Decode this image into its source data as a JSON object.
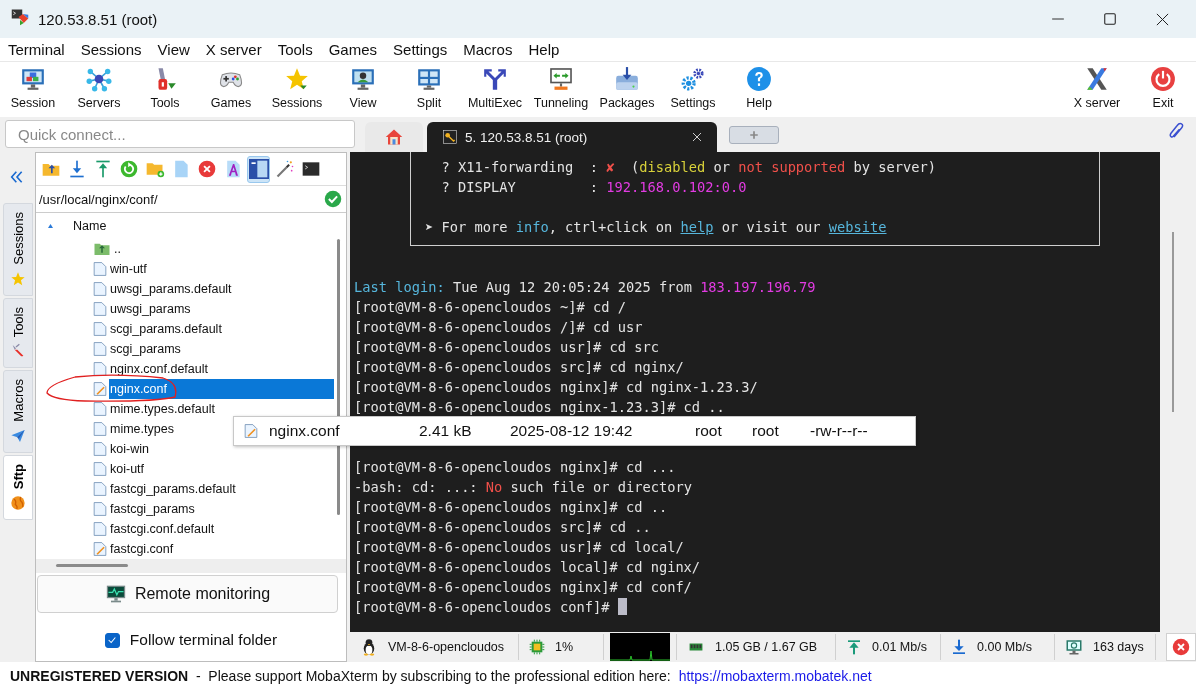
{
  "window": {
    "title": "120.53.8.51 (root)"
  },
  "menu": [
    "Terminal",
    "Sessions",
    "View",
    "X server",
    "Tools",
    "Games",
    "Settings",
    "Macros",
    "Help"
  ],
  "toolbar": [
    {
      "kind": "session",
      "label": "Session"
    },
    {
      "kind": "servers",
      "label": "Servers"
    },
    {
      "kind": "tools",
      "label": "Tools"
    },
    {
      "kind": "games",
      "label": "Games"
    },
    {
      "kind": "sessions",
      "label": "Sessions"
    },
    {
      "kind": "view",
      "label": "View"
    },
    {
      "kind": "split",
      "label": "Split"
    },
    {
      "kind": "multiexec",
      "label": "MultiExec"
    },
    {
      "kind": "tunneling",
      "label": "Tunneling"
    },
    {
      "kind": "packages",
      "label": "Packages"
    },
    {
      "kind": "settings",
      "label": "Settings"
    },
    {
      "kind": "help",
      "label": "Help"
    }
  ],
  "toolbar_right": [
    {
      "kind": "xserver",
      "label": "X server"
    },
    {
      "kind": "exit",
      "label": "Exit"
    }
  ],
  "quick_connect": {
    "placeholder": "Quick connect..."
  },
  "tabs": [
    {
      "kind": "home",
      "selected": false
    },
    {
      "kind": "session",
      "label": "5. 120.53.8.51 (root)",
      "selected": true
    },
    {
      "kind": "new"
    }
  ],
  "side_tabs": [
    {
      "kind": "sessions",
      "label": "Sessions",
      "selected": false
    },
    {
      "kind": "tools",
      "label": "Tools",
      "selected": false
    },
    {
      "kind": "macros",
      "label": "Macros",
      "selected": false
    },
    {
      "kind": "sftp",
      "label": "Sftp",
      "selected": true
    }
  ],
  "sftp": {
    "tools": [
      {
        "kind": "parent",
        "selected": false
      },
      {
        "kind": "download",
        "selected": false
      },
      {
        "kind": "upload",
        "selected": false
      },
      {
        "kind": "refresh",
        "selected": false
      },
      {
        "kind": "new-folder",
        "selected": false
      },
      {
        "kind": "new-file",
        "selected": false
      },
      {
        "kind": "delete",
        "selected": false
      },
      {
        "kind": "font",
        "selected": false
      },
      {
        "kind": "panel",
        "selected": true
      },
      {
        "kind": "wand",
        "selected": false
      },
      {
        "kind": "terminal",
        "selected": false
      }
    ],
    "path": "/usr/local/nginx/conf/",
    "column": "Name",
    "files": [
      {
        "name": "..",
        "kind": "parent",
        "selected": false
      },
      {
        "name": "win-utf",
        "kind": "file",
        "selected": false
      },
      {
        "name": "uwsgi_params.default",
        "kind": "file",
        "selected": false
      },
      {
        "name": "uwsgi_params",
        "kind": "file",
        "selected": false
      },
      {
        "name": "scgi_params.default",
        "kind": "file",
        "selected": false
      },
      {
        "name": "scgi_params",
        "kind": "file",
        "selected": false
      },
      {
        "name": "nginx.conf.default",
        "kind": "file",
        "selected": false
      },
      {
        "name": "nginx.conf",
        "kind": "conf",
        "selected": true
      },
      {
        "name": "mime.types.default",
        "kind": "file",
        "selected": false
      },
      {
        "name": "mime.types",
        "kind": "file",
        "selected": false
      },
      {
        "name": "koi-win",
        "kind": "file",
        "selected": false
      },
      {
        "name": "koi-utf",
        "kind": "file",
        "selected": false
      },
      {
        "name": "fastcgi_params.default",
        "kind": "file",
        "selected": false
      },
      {
        "name": "fastcgi_params",
        "kind": "file",
        "selected": false
      },
      {
        "name": "fastcgi.conf.default",
        "kind": "file",
        "selected": false
      },
      {
        "name": "fastcgi.conf",
        "kind": "conf",
        "selected": false
      }
    ],
    "remote_monitoring": "Remote monitoring",
    "follow": {
      "label": "Follow terminal folder",
      "checked": true
    }
  },
  "tooltip": {
    "name": "nginx.conf",
    "size": "2.41 kB",
    "date": "2025-08-12 19:42",
    "owner": "root",
    "group": "root",
    "permissions": "-rw-r--r--"
  },
  "terminal": {
    "banner": [
      {
        "segments": [
          {
            "text": "  ? X11-forwarding  : ",
            "kind": "plain"
          },
          {
            "text": "✘",
            "kind": "red"
          },
          {
            "text": "  (",
            "kind": "plain"
          },
          {
            "text": "disabled",
            "kind": "yellow"
          },
          {
            "text": " or ",
            "kind": "plain"
          },
          {
            "text": "not supported",
            "kind": "red"
          },
          {
            "text": " by server)",
            "kind": "plain"
          }
        ]
      },
      {
        "segments": [
          {
            "text": "  ? DISPLAY         : ",
            "kind": "plain"
          },
          {
            "text": "192.168.0.102:0.0",
            "kind": "magenta"
          }
        ]
      },
      {
        "segments": [
          {
            "text": "➤ For more ",
            "kind": "plain"
          },
          {
            "text": "info",
            "kind": "cyan"
          },
          {
            "text": ", ctrl+click on ",
            "kind": "plain"
          },
          {
            "text": "help",
            "kind": "link"
          },
          {
            "text": " or visit our ",
            "kind": "plain"
          },
          {
            "text": "website",
            "kind": "link"
          }
        ]
      }
    ],
    "lines": [
      {
        "segments": [
          {
            "text": "Last login:",
            "kind": "cyan"
          },
          {
            "text": " Tue Aug 12 20:05:24 2025 from ",
            "kind": "plain"
          },
          {
            "text": "183.197.196.79",
            "kind": "magenta"
          }
        ]
      },
      {
        "segments": [
          {
            "text": "[root@VM-8-6-opencloudos ~]# cd /",
            "kind": "plain"
          }
        ]
      },
      {
        "segments": [
          {
            "text": "[root@VM-8-6-opencloudos /]# cd usr",
            "kind": "plain"
          }
        ]
      },
      {
        "segments": [
          {
            "text": "[root@VM-8-6-opencloudos usr]# cd src",
            "kind": "plain"
          }
        ]
      },
      {
        "segments": [
          {
            "text": "[root@VM-8-6-opencloudos src]# cd nginx/",
            "kind": "plain"
          }
        ]
      },
      {
        "segments": [
          {
            "text": "[root@VM-8-6-opencloudos nginx]# cd nginx-1.23.3/",
            "kind": "plain"
          }
        ]
      },
      {
        "segments": [
          {
            "text": "[root@VM-8-6-opencloudos nginx-1.23.3]# cd ..",
            "kind": "plain"
          }
        ]
      },
      {
        "segments": [
          {
            "text": "[root@VM-8-6-opencloudos nginx]# cd ...",
            "kind": "plain"
          }
        ]
      },
      {
        "segments": [
          {
            "text": "-bash: cd: ...: ",
            "kind": "plain"
          },
          {
            "text": "No",
            "kind": "red"
          },
          {
            "text": " such file or directory",
            "kind": "plain"
          }
        ]
      },
      {
        "segments": [
          {
            "text": "[root@VM-8-6-opencloudos nginx]# cd ..",
            "kind": "plain"
          }
        ]
      },
      {
        "segments": [
          {
            "text": "[root@VM-8-6-opencloudos src]# cd ..",
            "kind": "plain"
          }
        ]
      },
      {
        "segments": [
          {
            "text": "[root@VM-8-6-opencloudos usr]# cd local/",
            "kind": "plain"
          }
        ]
      },
      {
        "segments": [
          {
            "text": "[root@VM-8-6-opencloudos local]# cd nginx/",
            "kind": "plain"
          }
        ]
      },
      {
        "segments": [
          {
            "text": "[root@VM-8-6-opencloudos nginx]# cd conf/",
            "kind": "plain"
          }
        ]
      },
      {
        "segments": [
          {
            "text": "[root@VM-8-6-opencloudos conf]# ",
            "kind": "plain"
          }
        ],
        "cursor": true
      }
    ]
  },
  "status": [
    {
      "kind": "host",
      "text": "VM-8-6-opencloudos"
    },
    {
      "kind": "cpu",
      "text": "1%"
    },
    {
      "kind": "graph"
    },
    {
      "kind": "memory",
      "text": "1.05 GB / 1.67 GB"
    },
    {
      "kind": "upload",
      "text": "0.01 Mb/s"
    },
    {
      "kind": "download",
      "text": "0.00 Mb/s"
    },
    {
      "kind": "uptime",
      "text": "163 days"
    },
    {
      "kind": "close"
    }
  ],
  "footer": {
    "notice": "**UNREGISTERED VERSION**  -  Please support MobaXterm by subscribing to the professional edition here:",
    "link": "https://mobaxterm.mobatek.net"
  }
}
